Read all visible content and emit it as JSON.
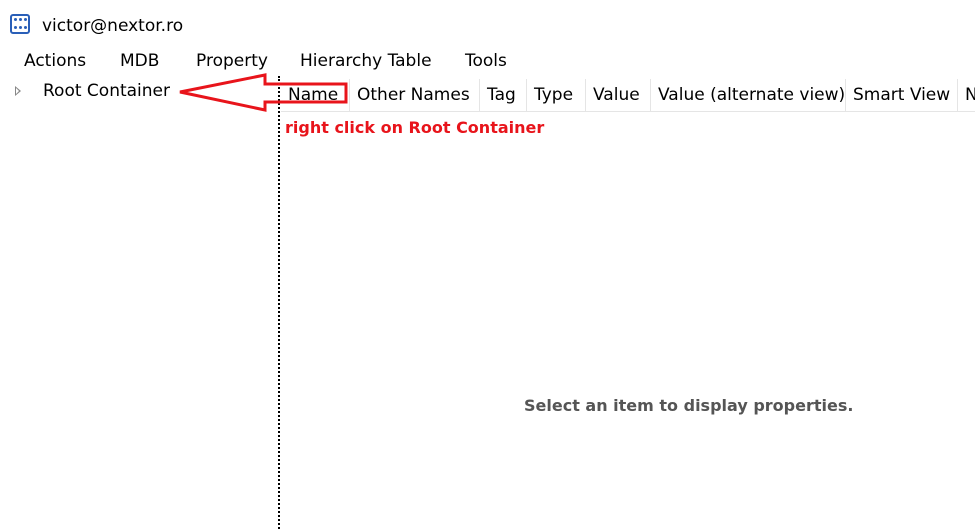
{
  "window": {
    "title": "victor@nextor.ro",
    "icon": "app-grid-icon"
  },
  "menu": {
    "items": [
      "Actions",
      "MDB",
      "Property",
      "Hierarchy Table",
      "Tools"
    ]
  },
  "tree": {
    "nodes": [
      {
        "label": "Root Container",
        "expander": "collapsed-triangle-icon"
      }
    ]
  },
  "properties": {
    "columns": [
      "Name",
      "Other Names",
      "Tag",
      "Type",
      "Value",
      "Value (alternate view)",
      "Smart View",
      "N"
    ],
    "empty_message": "Select an item to display properties."
  },
  "annotation": {
    "text": "right click on Root Container",
    "color": "#e8141b",
    "shape": "red-arrow-pointing-left"
  }
}
